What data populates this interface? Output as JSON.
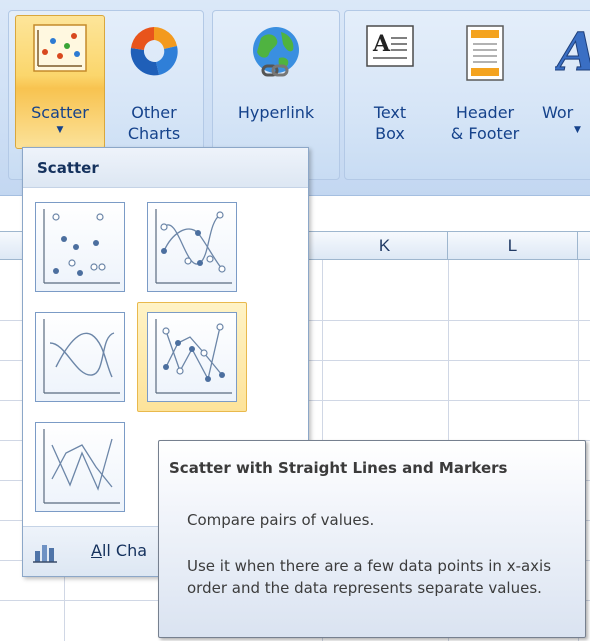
{
  "ribbon": {
    "buttons": [
      {
        "id": "scatter",
        "label_line1": "Scatter",
        "label_line2": "",
        "icon": "scatter-chart-icon",
        "has_dropdown": true,
        "active": true
      },
      {
        "id": "other-charts",
        "label_line1": "Other",
        "label_line2": "Charts",
        "icon": "donut-chart-icon",
        "has_dropdown": true
      },
      {
        "id": "hyperlink",
        "label_line1": "Hyperlink",
        "label_line2": "",
        "icon": "globe-link-icon",
        "has_dropdown": false
      },
      {
        "id": "text-box",
        "label_line1": "Text",
        "label_line2": "Box",
        "icon": "text-box-icon",
        "has_dropdown": false
      },
      {
        "id": "header-footer",
        "label_line1": "Header",
        "label_line2": "& Footer",
        "icon": "header-footer-icon",
        "has_dropdown": false
      },
      {
        "id": "wordart",
        "label_line1": "Wor",
        "label_line2": "",
        "icon": "wordart-icon",
        "has_dropdown": true
      }
    ]
  },
  "sheet": {
    "columns": [
      "K",
      "L"
    ]
  },
  "dropdown": {
    "title": "Scatter",
    "options": [
      {
        "id": "scatter-markers-only",
        "icon": "scatter-markers-only-icon"
      },
      {
        "id": "scatter-smooth-lines-markers",
        "icon": "scatter-smooth-lines-markers-icon"
      },
      {
        "id": "scatter-smooth-lines",
        "icon": "scatter-smooth-lines-icon"
      },
      {
        "id": "scatter-straight-lines-markers",
        "icon": "scatter-straight-lines-markers-icon",
        "hovered": true
      },
      {
        "id": "scatter-straight-lines",
        "icon": "scatter-straight-lines-icon"
      }
    ],
    "footer": {
      "label_underlined": "A",
      "label_rest": "ll Cha",
      "icon": "all-charts-icon"
    }
  },
  "tooltip": {
    "title": "Scatter with Straight Lines and Markers",
    "description": "Compare pairs of values.",
    "detail": "Use it when there are a few data points in x-axis order and the data represents separate values."
  },
  "colors": {
    "ribbon_text": "#15428b",
    "active_button": "#fbd66c",
    "hover_option": "#fde39a",
    "grid_line": "#d0d7e5"
  }
}
